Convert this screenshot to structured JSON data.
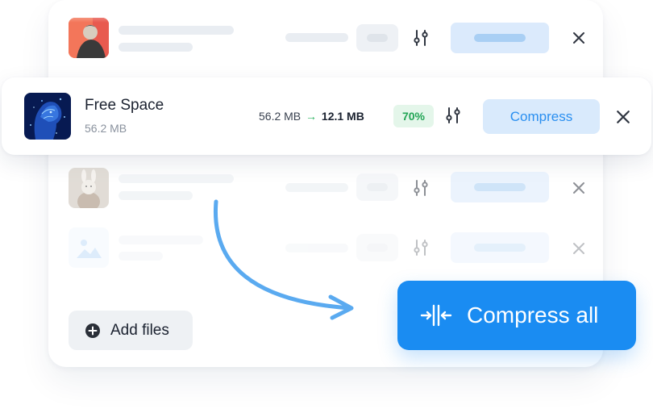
{
  "active_file": {
    "name": "Free Space",
    "size": "56.2 MB",
    "original_size": "56.2 MB",
    "arrow": "→",
    "compressed_size": "12.1 MB",
    "reduction": "70%",
    "compress_label": "Compress"
  },
  "actions": {
    "add_files_label": "Add files",
    "compress_all_label": "Compress all"
  },
  "icons": {
    "settings": "sliders-icon",
    "remove": "close-icon",
    "add": "plus-circle-icon",
    "compress_all": "compress-arrows-icon",
    "flow": "curved-arrow-icon",
    "placeholder": "image-placeholder-icon"
  },
  "colors": {
    "accent": "#1a8cf2",
    "accent_light": "#d9eafc",
    "success": "#22a555",
    "success_bg": "#e4f6ea"
  }
}
